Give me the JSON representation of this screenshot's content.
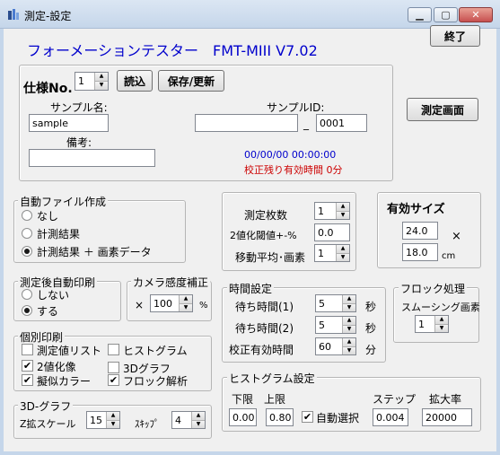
{
  "window": {
    "title": "測定-設定",
    "min_label": "▁",
    "max_label": "▢",
    "close_label": "✕"
  },
  "header": {
    "app_title": "フォーメーションテスター　FMT-MIII V7.02",
    "exit_button": "終了",
    "title_color": "#0000cc"
  },
  "spec": {
    "spec_no_label": "仕様No.",
    "spec_no_value": "1",
    "load_button": "読込",
    "save_button": "保存/更新",
    "sample_name_label": "サンプル名:",
    "sample_name_value": "sample",
    "sample_id_label": "サンプルID:",
    "sample_id_value": "",
    "sample_id_sep": "_",
    "sample_id_suffix": "0001",
    "remarks_label": "備考:",
    "remarks_value": "",
    "timestamp": "00/00/00 00:00:00",
    "calibration_remaining": "校正残り有効時間 0分",
    "timestamp_color": "#0000cc",
    "calibration_color": "#cc0000"
  },
  "measure_screen_button": "測定画面",
  "auto_file": {
    "title": "自動ファイル作成",
    "options": [
      "なし",
      "計測結果",
      "計測結果 ＋ 画素データ"
    ],
    "selected_index": 2
  },
  "measure_params": {
    "count_label": "測定枚数",
    "count_value": "1",
    "threshold_label": "2値化閾値+-%",
    "threshold_value": "0.0",
    "moving_avg_label": "移動平均･画素",
    "moving_avg_value": "1"
  },
  "effective_size": {
    "title": "有効サイズ",
    "width": "24.0",
    "height": "18.0",
    "times": "×",
    "unit": "cm"
  },
  "auto_print": {
    "title": "測定後自動印刷",
    "options": [
      "しない",
      "する"
    ],
    "selected_index": 1
  },
  "camera": {
    "title": "カメラ感度補正",
    "prefix": "×",
    "value": "100",
    "unit": "%"
  },
  "time_settings": {
    "title": "時間設定",
    "wait1_label": "待ち時間(1)",
    "wait1_value": "5",
    "wait1_unit": "秒",
    "wait2_label": "待ち時間(2)",
    "wait2_value": "5",
    "wait2_unit": "秒",
    "calib_label": "校正有効時間",
    "calib_value": "60",
    "calib_unit": "分"
  },
  "flock": {
    "title": "フロック処理",
    "smoothing_label": "スムーシング画素",
    "smoothing_value": "1"
  },
  "individual_print": {
    "title": "個別印刷",
    "items": [
      {
        "label": "測定値リスト",
        "checked": false
      },
      {
        "label": "ヒストグラム",
        "checked": false
      },
      {
        "label": "2値化像",
        "checked": true
      },
      {
        "label": "3Dグラフ",
        "checked": false
      },
      {
        "label": "擬似カラー",
        "checked": true
      },
      {
        "label": "フロック解析",
        "checked": true
      }
    ]
  },
  "graph3d": {
    "title": "3D-グラフ",
    "z_scale_label": "Z拡スケール",
    "z_scale_value": "15",
    "skip_label": "ｽｷｯﾌﾟ",
    "skip_value": "4"
  },
  "histogram": {
    "title": "ヒストグラム設定",
    "lower_label": "下限",
    "lower_value": "0.00",
    "upper_label": "上限",
    "upper_value": "0.80",
    "auto_label": "自動選択",
    "auto_checked": true,
    "step_label": "ステップ",
    "step_value": "0.004",
    "zoom_label": "拡大率",
    "zoom_value": "20000"
  },
  "icons": {
    "app": "app-icon",
    "spin_up": "▲",
    "spin_down": "▼",
    "check": "✔"
  }
}
